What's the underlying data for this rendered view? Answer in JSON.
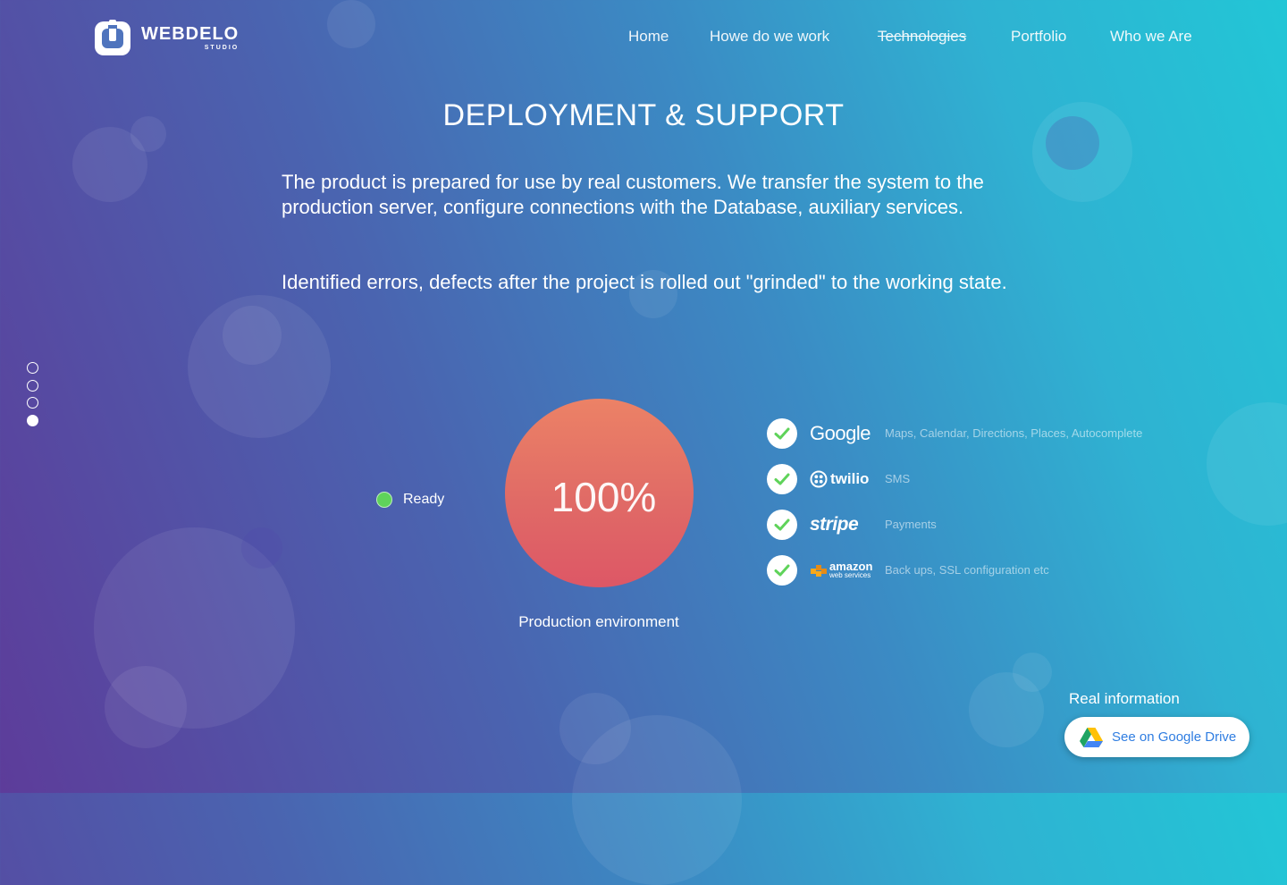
{
  "brand": {
    "name": "WEBDELO",
    "sub": "STUDIO"
  },
  "nav": [
    {
      "label": "Home"
    },
    {
      "label": "Howe do we work"
    },
    {
      "label": "Technologies"
    },
    {
      "label": "Portfolio"
    },
    {
      "label": "Who we Are"
    }
  ],
  "section": {
    "title": "DEPLOYMENT & SUPPORT",
    "paragraph1": "The product is prepared for use by real customers. We transfer the system to the production server, configure connections with the Database, auxiliary services.",
    "paragraph2": "Identified errors, defects after the project is rolled out \"grinded\" to the working state."
  },
  "pagination": {
    "total": 4,
    "active_index": 3
  },
  "status": {
    "label": "Ready",
    "color": "#5fd35a"
  },
  "gauge": {
    "value_text": "100%",
    "progress": 1.0,
    "caption": "Production environment"
  },
  "services": [
    {
      "brand": "Google",
      "note": "Maps, Calendar, Directions, Places, Autocomplete",
      "icon": "check-icon"
    },
    {
      "brand": "twilio",
      "note": "SMS",
      "icon": "check-icon"
    },
    {
      "brand": "stripe",
      "note": "Payments",
      "icon": "check-icon"
    },
    {
      "brand": "amazon",
      "brand_sub": "web services",
      "note": "Back ups, SSL configuration etc",
      "icon": "check-icon"
    }
  ],
  "cta": {
    "heading": "Real information",
    "button_label": "See on Google Drive"
  },
  "colors": {
    "check": "#5fd35a",
    "drive_label": "#2f7de1"
  }
}
